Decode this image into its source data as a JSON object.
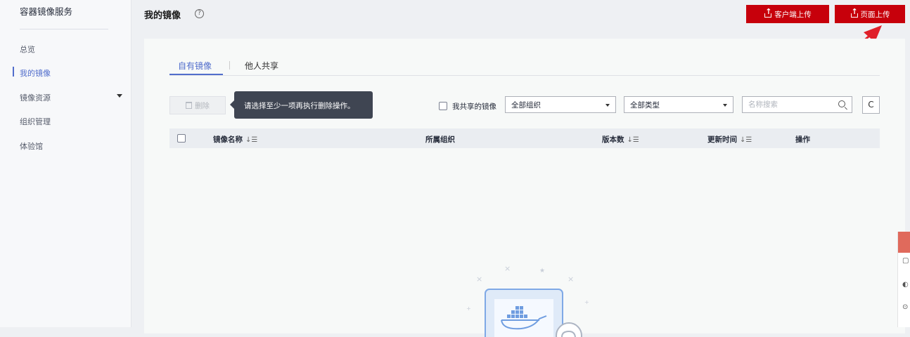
{
  "sidebar": {
    "service_title": "容器镜像服务",
    "items": [
      {
        "label": "总览"
      },
      {
        "label": "我的镜像"
      },
      {
        "label": "镜像资源"
      },
      {
        "label": "组织管理"
      },
      {
        "label": "体验馆"
      }
    ]
  },
  "header": {
    "title": "我的镜像",
    "help_icon": "?",
    "client_upload_label": "客户端上传",
    "page_upload_label": "页面上传"
  },
  "tabs": [
    {
      "label": "自有镜像",
      "active": true
    },
    {
      "label": "他人共享",
      "active": false
    }
  ],
  "toolbar": {
    "delete_label": "删除",
    "tooltip": "请选择至少一项再执行删除操作。",
    "shared_filter_label": "我共享的镜像",
    "org_select": "全部组织",
    "type_select": "全部类型",
    "search_placeholder": "名称搜索",
    "refresh_icon": "C"
  },
  "table": {
    "columns": [
      "镜像名称",
      "所属组织",
      "版本数",
      "更新时间",
      "操作"
    ],
    "rows": []
  },
  "colors": {
    "primary_red": "#c7000b",
    "accent_blue": "#526ecc",
    "annotation_arrow": "#e0202a"
  }
}
